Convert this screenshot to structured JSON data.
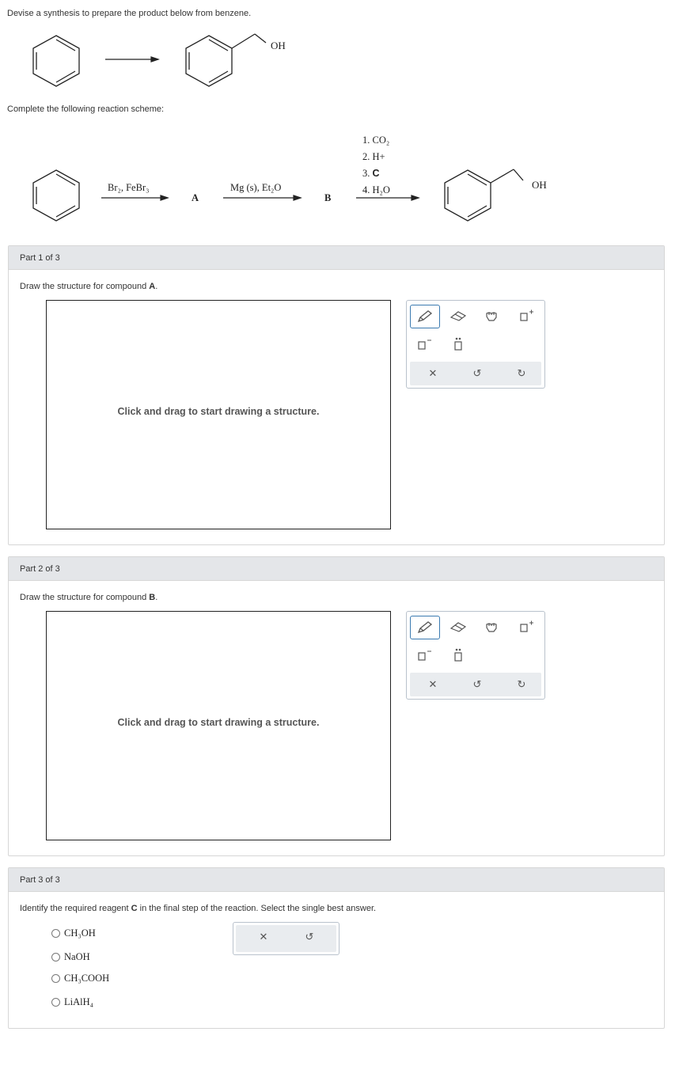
{
  "question": {
    "intro": "Devise a synthesis to prepare the product below from benzene.",
    "product_oh": "OH",
    "scheme_label": "Complete the following reaction scheme:"
  },
  "scheme": {
    "reagent1": "Br₂, FeBr₃",
    "compound_a": "A",
    "reagent2": "Mg (s), Et₂O",
    "compound_b": "B",
    "steps": [
      "1. CO₂",
      "2. H+",
      "3. ",
      "4. H₂O"
    ],
    "step3_bold": "C",
    "product_oh": "OH"
  },
  "parts": [
    {
      "header": "Part 1 of 3",
      "prompt_pre": "Draw the structure for compound ",
      "prompt_bold": "A",
      "prompt_post": ".",
      "canvas_hint": "Click and drag to start drawing a structure."
    },
    {
      "header": "Part 2 of 3",
      "prompt_pre": "Draw the structure for compound ",
      "prompt_bold": "B",
      "prompt_post": ".",
      "canvas_hint": "Click and drag to start drawing a structure."
    },
    {
      "header": "Part 3 of 3",
      "prompt_pre": "Identify the required reagent ",
      "prompt_bold": "C",
      "prompt_post": " in the final step of the reaction. Select the single best answer."
    }
  ],
  "options": [
    "CH₃OH",
    "NaOH",
    "CH₃COOH",
    "LiAlH₄"
  ],
  "tools": [
    "pencil-icon",
    "eraser-icon",
    "hand-icon",
    "add-template-icon",
    "charge-icon",
    "lone-pair-icon",
    "clear-icon",
    "undo-icon",
    "redo-icon"
  ],
  "colors": {
    "panel_header": "#e4e6e9",
    "tool_select": "#3a7ab0",
    "toolbar_bg": "#e9ecef"
  }
}
